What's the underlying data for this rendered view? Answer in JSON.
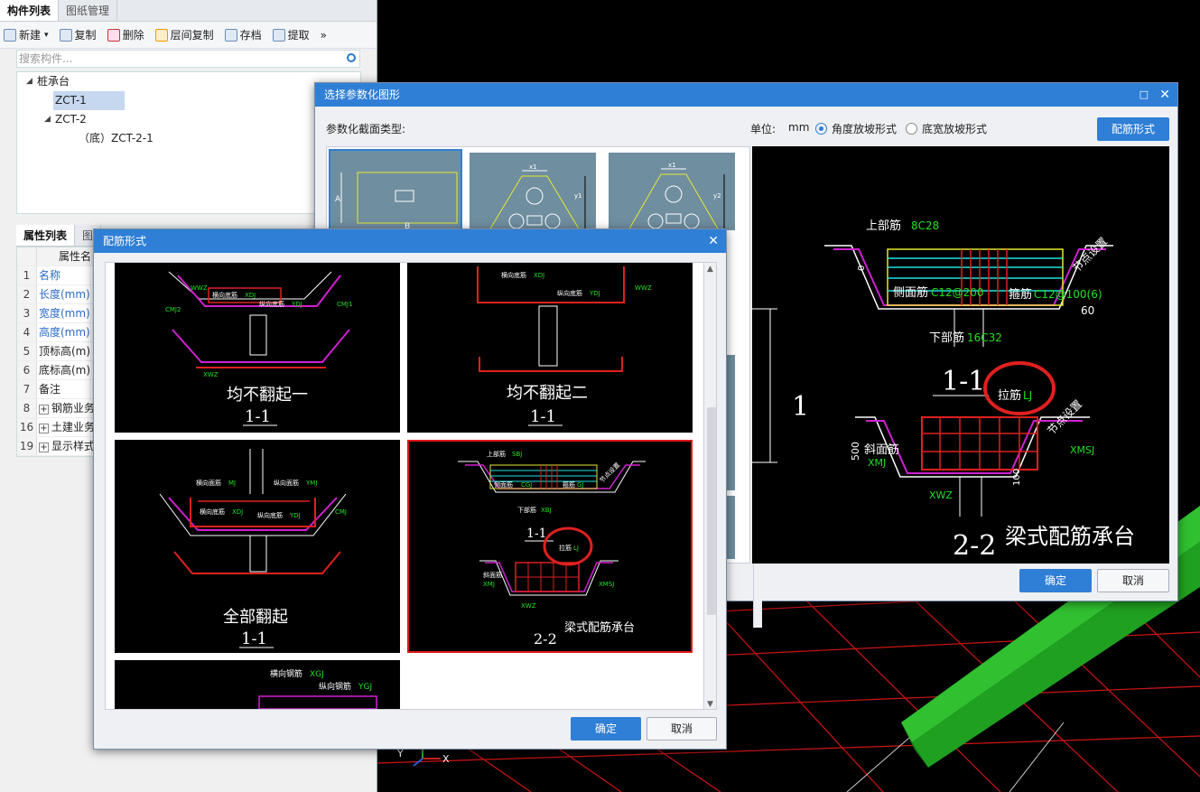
{
  "left": {
    "tabs": [
      "构件列表",
      "图纸管理"
    ],
    "toolbar": [
      "新建",
      "复制",
      "删除",
      "层间复制",
      "存档",
      "提取"
    ],
    "new_arrow": "▾",
    "more": "»",
    "search_placeholder": "搜索构件...",
    "tree": [
      {
        "label": "桩承台",
        "level": 0
      },
      {
        "label": "ZCT-1",
        "level": 1
      },
      {
        "label": "ZCT-2",
        "level": 1
      },
      {
        "label": "（底）ZCT-2-1",
        "level": 2
      }
    ],
    "props_tabs": [
      "属性列表",
      "图"
    ],
    "props_header": "属性名",
    "props": [
      {
        "num": "1",
        "name": "名称",
        "blue": true
      },
      {
        "num": "2",
        "name": "长度(mm)",
        "blue": true
      },
      {
        "num": "3",
        "name": "宽度(mm)",
        "blue": true
      },
      {
        "num": "4",
        "name": "高度(mm)",
        "blue": true
      },
      {
        "num": "5",
        "name": "顶标高(m)",
        "blue": false
      },
      {
        "num": "6",
        "name": "底标高(m)",
        "blue": false
      },
      {
        "num": "7",
        "name": "备注",
        "blue": false
      },
      {
        "num": "8",
        "name": "钢筋业务",
        "blue": false,
        "plus": true
      },
      {
        "num": "16",
        "name": "土建业务",
        "blue": false,
        "plus": true
      },
      {
        "num": "19",
        "name": "显示样式",
        "blue": false,
        "plus": true
      }
    ]
  },
  "param_dialog": {
    "title": "选择参数化图形",
    "section_label": "参数化截面类型:",
    "unit_label": "单位:",
    "unit_value": "mm",
    "radio1": "角度放坡形式",
    "radio2": "底宽放坡形式",
    "rebar_button": "配筋形式",
    "ok": "确定",
    "cancel": "取消",
    "preview": {
      "top_rebar": "上部筋",
      "top_rebar_val": "8C28",
      "side_rebar": "侧面筋",
      "side_rebar_val": "C12@200",
      "stirrup": "箍筋",
      "stirrup_val": "C12@100(6)",
      "bottom_rebar": "下部筋",
      "bottom_rebar_val": "16C32",
      "section11": "1-1",
      "tie": "拉筋",
      "tie_val": "LJ",
      "section22": "2-2",
      "title": "梁式配筋承台",
      "angle": "60",
      "dim500": "500",
      "dim100": "100",
      "slope_rebar": "斜面筋",
      "slope_val": "XMJ",
      "xmsj": "XMSJ",
      "xwz": "XWZ",
      "node_set": "节点设置",
      "h0": "0",
      "side_label": "1"
    },
    "thumb_labels": {
      "a": "A",
      "b": "B",
      "x1": "x1",
      "y1": "y1",
      "y2": "y2"
    }
  },
  "rebar_dialog": {
    "title": "配筋形式",
    "ok": "确定",
    "cancel": "取消",
    "items": [
      {
        "title": "均不翻起一",
        "section": "1-1",
        "labels": [
          "横向底筋",
          "XDJ",
          "纵向底筋",
          "YDJ",
          "CMJ2",
          "CMJ1",
          "XWZ",
          "WWZ"
        ]
      },
      {
        "title": "均不翻起二",
        "section": "1-1",
        "labels": [
          "横向底筋",
          "XDJ",
          "纵向底筋",
          "YDJ",
          "WWZ"
        ]
      },
      {
        "title": "全部翻起",
        "section": "1-1",
        "labels": [
          "横向面筋",
          "MJ",
          "纵向面筋",
          "YMJ",
          "横向底筋",
          "XDJ",
          "纵向底筋",
          "YDJ",
          "CMJ"
        ]
      },
      {
        "title": "梁式配筋承台",
        "section": "2-2",
        "labels": [
          "上部筋",
          "SBJ",
          "侧面筋",
          "CGJ",
          "箍筋",
          "GJ",
          "下部筋",
          "XBJ",
          "拉筋",
          "LJ",
          "斜面筋",
          "XMJ",
          "XMSJ",
          "XWZ",
          "1-1",
          "节点设置"
        ]
      },
      {
        "title": "",
        "section": "",
        "labels": [
          "横向钢筋",
          "XGJ",
          "纵向钢筋",
          "YGJ"
        ]
      }
    ]
  },
  "axes": {
    "x": "X",
    "y": "Y"
  }
}
